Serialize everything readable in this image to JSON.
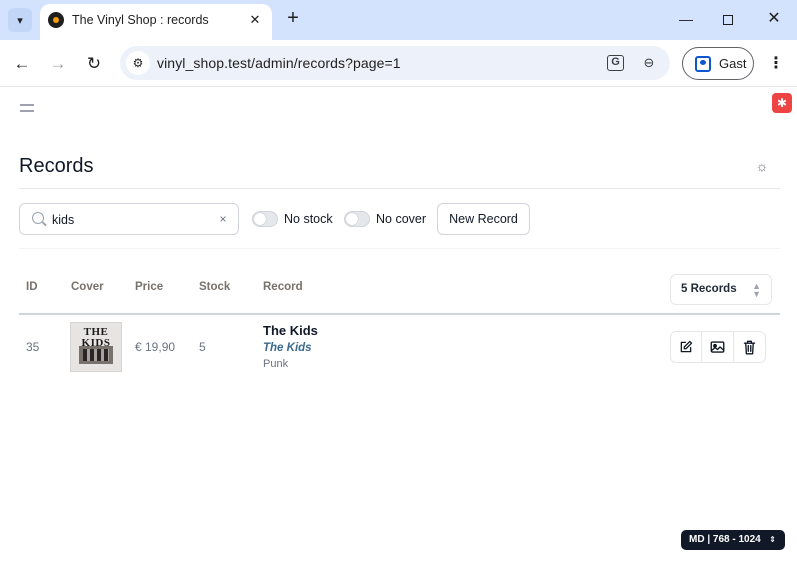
{
  "browser": {
    "tab_title": "The Vinyl Shop : records",
    "new_tab": "+",
    "url": "vinyl_shop.test/admin/records?page=1",
    "profile_label": "Gast",
    "window_controls": {
      "minimize": "—",
      "close": "✕"
    }
  },
  "page": {
    "title": "Records",
    "search": {
      "value": "kids",
      "clear": "×"
    },
    "filters": {
      "no_stock": "No stock",
      "no_cover": "No cover"
    },
    "new_record_label": "New Record",
    "table": {
      "columns": [
        "ID",
        "Cover",
        "Price",
        "Stock",
        "Record"
      ],
      "per_page_label": "5 Records",
      "rows": [
        {
          "id": "35",
          "cover_text": "THE\nKIDS",
          "price": "€ 19,90",
          "stock": "5",
          "title": "The Kids",
          "artist": "The Kids",
          "genre": "Punk"
        }
      ]
    },
    "actions": [
      "edit-icon",
      "image-icon",
      "trash-icon"
    ],
    "screen_indicator": "MD | 768 - 1024"
  },
  "icons": {
    "debug": "bug-icon",
    "theme": "sun-icon",
    "menu": "hamburger-icon"
  },
  "colors": {
    "tabstrip": "#d3e3fd",
    "debug_badge": "#ef4444",
    "artist_link": "#3b6a8f",
    "screen_indicator_bg": "#111827"
  }
}
